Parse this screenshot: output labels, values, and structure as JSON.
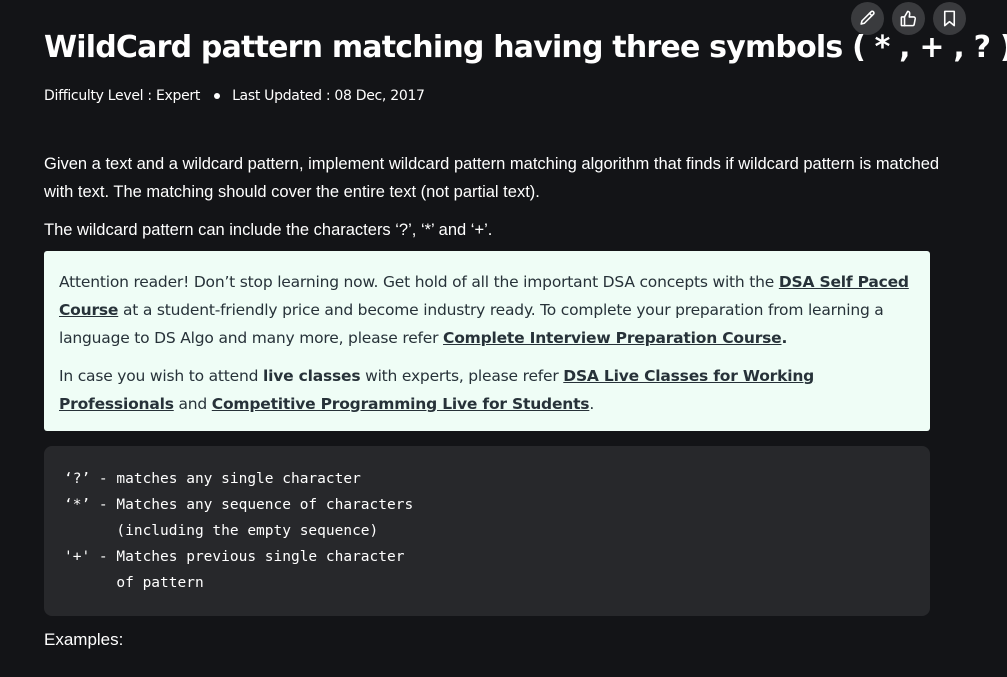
{
  "toolbar": {
    "edit_icon": "pencil-icon",
    "like_icon": "thumbs-up-icon",
    "bookmark_icon": "bookmark-icon",
    "button_bg": "#3a3b3e"
  },
  "article": {
    "title": "WildCard pattern matching having three symbols ( * , + , ? )",
    "difficulty": "Difficulty Level : Expert",
    "last_updated": "Last Updated : 08 Dec, 2017"
  },
  "intro": {
    "paragraph1": "Given a text and a wildcard pattern, implement wildcard pattern matching algorithm that finds if wildcard pattern is matched with text. The matching should cover the entire text (not partial text).",
    "paragraph2": "The wildcard pattern can include the characters ‘?’, ‘*’ and ‘+’."
  },
  "callout": {
    "p1_text1": "Attention reader! Don’t stop learning now. Get hold of all the important DSA concepts with the ",
    "p1_link1": "DSA Self Paced Course",
    "p1_text2": " at a student-friendly price and become industry ready.  To complete your preparation from learning a language to DS Algo and many more,  please refer ",
    "p1_link2": "Complete Interview Preparation Course",
    "p1_text3": ".",
    "p2_text1": "In case you wish to attend ",
    "p2_bold": "live classes",
    "p2_text2": " with experts, please refer ",
    "p2_link1": "DSA Live Classes for Working Professionals",
    "p2_text3": " and ",
    "p2_link2": "Competitive Programming Live for Students",
    "p2_text4": ".",
    "background": "#effdf6",
    "text_color": "#273239"
  },
  "code": {
    "content": "‘?’ - matches any single character\n‘*’ - Matches any sequence of characters\n      (including the empty sequence)\n'+' - Matches previous single character\n      of pattern"
  },
  "examples": {
    "heading": "Examples:"
  },
  "colors": {
    "page_bg": "#131417",
    "code_bg": "#27282b"
  }
}
